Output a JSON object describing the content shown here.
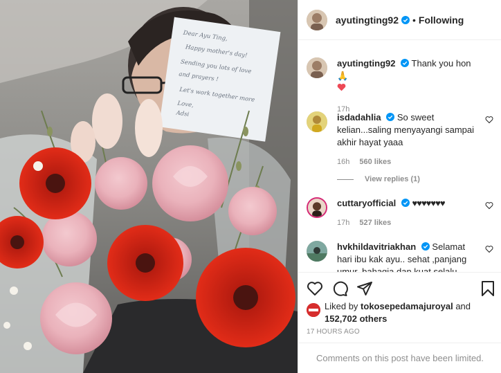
{
  "post": {
    "author": "ayutingting92",
    "follow_label": "Following",
    "separator": "•",
    "photo_card_lines": [
      "Dear Ayu Ting,",
      "Happy mother's day!",
      "Sending you lots of love",
      "and prayers !",
      "Let's work together more",
      "Love,",
      "Adsi"
    ]
  },
  "comments": [
    {
      "user": "ayutingting92",
      "text": "Thank you hon 🙏",
      "time": "17h"
    },
    {
      "user": "isdadahlia",
      "text": "So sweet kelian...saling menyayangi sampai akhir hayat yaaa",
      "time": "16h",
      "likes": "560 likes"
    },
    {
      "user": "cuttaryofficial",
      "text": "♥♥♥♥♥♥♥",
      "time": "17h",
      "likes": "527 likes"
    },
    {
      "user": "hvkhildavitriakhan",
      "text": "Selamat hari ibu kak ayu.. sehat ,panjang umur, bahagia dan kuat selalu"
    }
  ],
  "view_replies": "View replies (1)",
  "likes_line": {
    "prefix": "Liked by ",
    "user": "tokosepedamajuroyal",
    "middle": " and",
    "count": "152,702 others"
  },
  "timestamp": "17 HOURS AGO",
  "footer_note": "Comments on this post have been limited.",
  "colors": {
    "accent": "#0095f6",
    "heart": "#ed4956",
    "muted": "#8e8e8e"
  },
  "icons": [
    "verified-badge-icon",
    "heart-icon",
    "comment-icon",
    "share-icon",
    "bookmark-icon"
  ]
}
